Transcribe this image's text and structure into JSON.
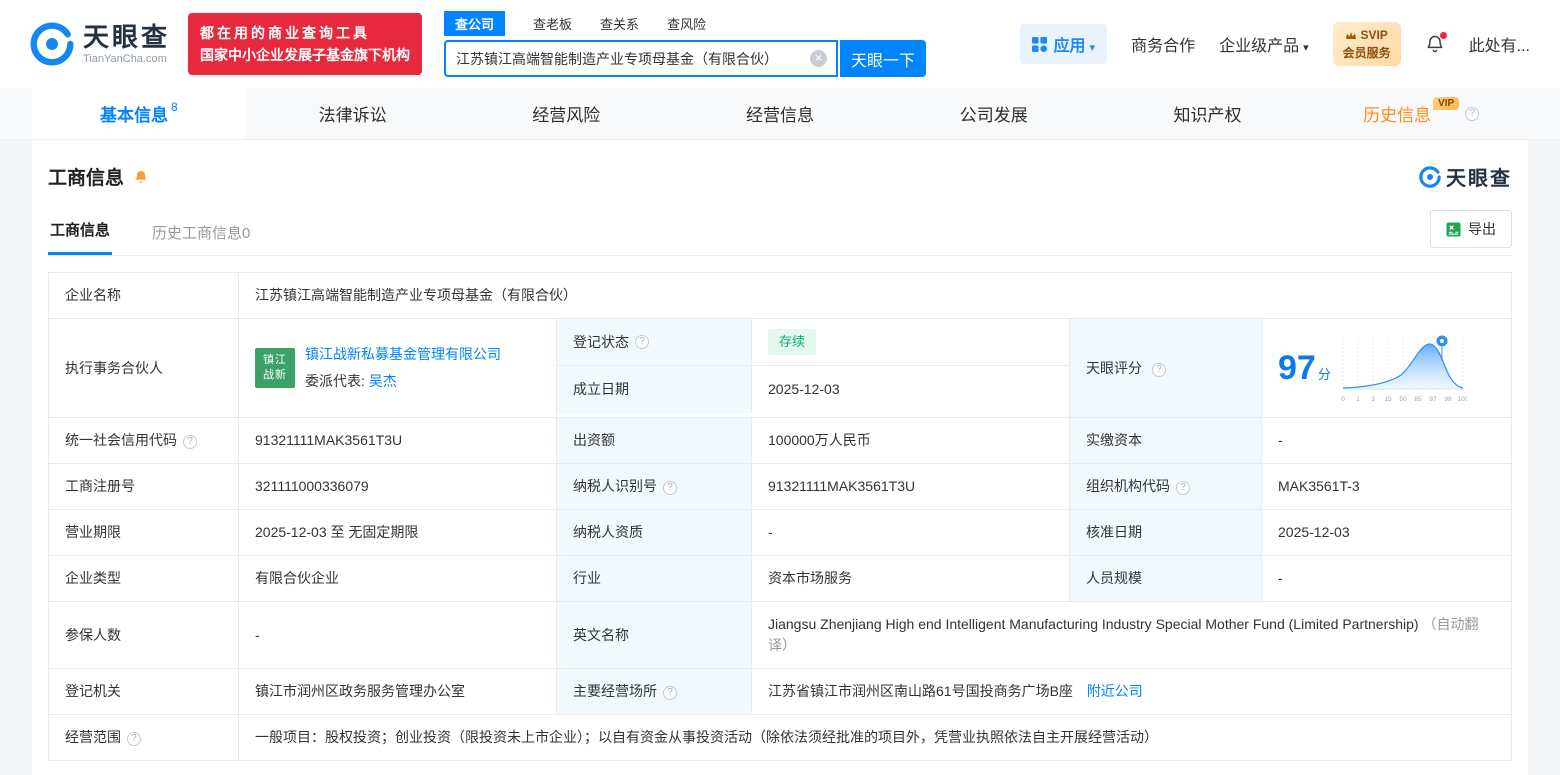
{
  "colors": {
    "primary_blue": "#0084ff",
    "brand_red": "#e7293d",
    "vip_orange": "#ff8c1a",
    "status_green": "#00b26a"
  },
  "brand": {
    "name": "天眼查",
    "domain": "TianYanCha.com",
    "slogan_line1": "都在用的商业查询工具",
    "slogan_line2": "国家中小企业发展子基金旗下机构"
  },
  "search": {
    "tabs": [
      {
        "label": "查公司"
      },
      {
        "label": "查老板"
      },
      {
        "label": "查关系"
      },
      {
        "label": "查风险"
      }
    ],
    "value": "江苏镇江高端智能制造产业专项母基金（有限合伙）",
    "button": "天眼一下"
  },
  "header_right": {
    "apps": "应用",
    "business": "商务合作",
    "enterprise": "企业级产品",
    "svip_top": "SVIP",
    "svip_bottom": "会员服务",
    "more": "此处有..."
  },
  "nav": {
    "tabs": [
      {
        "label": "基本信息",
        "badge": "8"
      },
      {
        "label": "法律诉讼"
      },
      {
        "label": "经营风险"
      },
      {
        "label": "经营信息"
      },
      {
        "label": "公司发展"
      },
      {
        "label": "知识产权"
      },
      {
        "label": "历史信息",
        "vip": "VIP"
      }
    ]
  },
  "section": {
    "title": "工商信息",
    "brand": "天眼查",
    "subtabs": [
      {
        "label": "工商信息"
      },
      {
        "label": "历史工商信息0"
      }
    ],
    "export": "导出"
  },
  "score_chart": {
    "type": "area",
    "score": "97",
    "unit": "分",
    "ticks": [
      "0",
      "1",
      "3",
      "15",
      "50",
      "85",
      "97",
      "99",
      "100"
    ]
  },
  "fields": {
    "company_name_label": "企业名称",
    "company_name": "江苏镇江高端智能制造产业专项母基金（有限合伙）",
    "partner_label": "执行事务合伙人",
    "partner_logo_line1": "镇江",
    "partner_logo_line2": "战新",
    "partner_name": "镇江战新私募基金管理有限公司",
    "rep_label": "委派代表:",
    "rep_name": "吴杰",
    "status_label": "登记状态",
    "status": "存续",
    "est_label": "成立日期",
    "est_date": "2025-12-03",
    "score_label": "天眼评分",
    "uscc_label": "统一社会信用代码",
    "uscc": "91321111MAK3561T3U",
    "capital_label": "出资额",
    "capital": "100000万人民币",
    "paid_label": "实缴资本",
    "paid": "-",
    "regno_label": "工商注册号",
    "regno": "321111000336079",
    "tax_label": "纳税人识别号",
    "tax_id": "91321111MAK3561T3U",
    "org_label": "组织机构代码",
    "org_code": "MAK3561T-3",
    "term_label": "营业期限",
    "term": "2025-12-03 至 无固定期限",
    "taxqual_label": "纳税人资质",
    "taxqual": "-",
    "approve_label": "核准日期",
    "approve_date": "2025-12-03",
    "type_label": "企业类型",
    "type": "有限合伙企业",
    "industry_label": "行业",
    "industry": "资本市场服务",
    "staff_label": "人员规模",
    "staff": "-",
    "insured_label": "参保人数",
    "insured": "-",
    "en_label": "英文名称",
    "en_name": "Jiangsu Zhenjiang High end Intelligent Manufacturing Industry Special Mother Fund (Limited Partnership)",
    "en_note": "（自动翻译）",
    "authority_label": "登记机关",
    "authority": "镇江市润州区政务服务管理办公室",
    "address_label": "主要经营场所",
    "address": "江苏省镇江市润州区南山路61号国投商务广场B座",
    "nearby": "附近公司",
    "scope_label": "经营范围",
    "scope": "一般项目：股权投资；创业投资（限投资未上市企业）；以自有资金从事投资活动（除依法须经批准的项目外，凭营业执照依法自主开展经营活动）"
  }
}
